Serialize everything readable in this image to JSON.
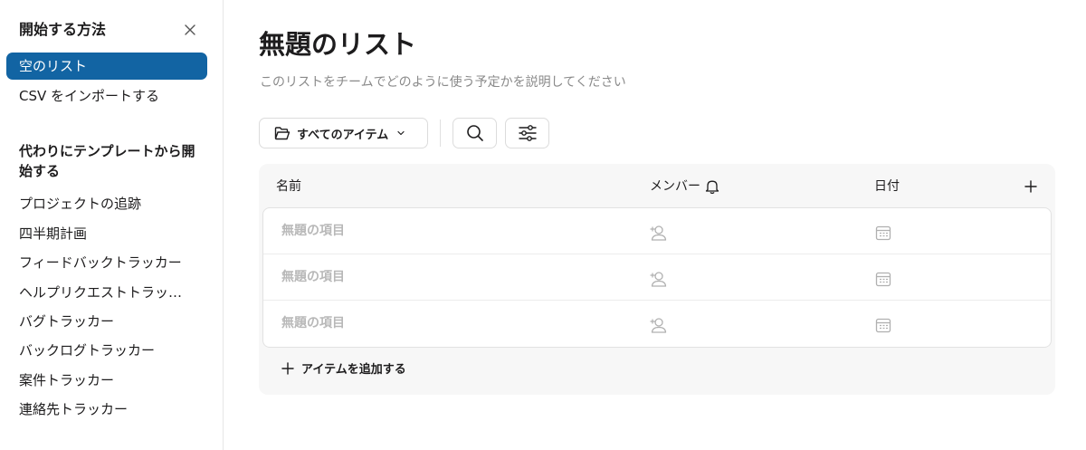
{
  "sidebar": {
    "title": "開始する方法",
    "close_icon": "close-icon",
    "start_items": [
      {
        "label": "空のリスト",
        "active": true
      },
      {
        "label": "CSV をインポートする",
        "active": false
      }
    ],
    "section_heading": "代わりにテンプレートから開始する",
    "templates": [
      {
        "label": "プロジェクトの追跡"
      },
      {
        "label": "四半期計画"
      },
      {
        "label": "フィードバックトラッカー"
      },
      {
        "label": "ヘルプリクエストトラッカー"
      },
      {
        "label": "バグトラッカー"
      },
      {
        "label": "バックログトラッカー"
      },
      {
        "label": "案件トラッカー"
      },
      {
        "label": "連絡先トラッカー"
      }
    ]
  },
  "main": {
    "title": "無題のリスト",
    "description": "このリストをチームでどのように使う予定かを説明してください",
    "toolbar": {
      "view_label": "すべてのアイテム",
      "view_icon": "folder-icon",
      "search_icon": "search-icon",
      "filter_icon": "filter-sliders-icon"
    },
    "table": {
      "columns": {
        "name": "名前",
        "members": "メンバー",
        "date": "日付"
      },
      "rows": [
        {
          "name": "無題の項目"
        },
        {
          "name": "無題の項目"
        },
        {
          "name": "無題の項目"
        }
      ],
      "add_item_label": "アイテムを追加する"
    }
  },
  "colors": {
    "accent": "#1264a3",
    "text": "#1d1c1d",
    "muted": "#8a8a8a",
    "placeholder": "#b8b8b8",
    "table_bg": "#f7f7f7"
  }
}
